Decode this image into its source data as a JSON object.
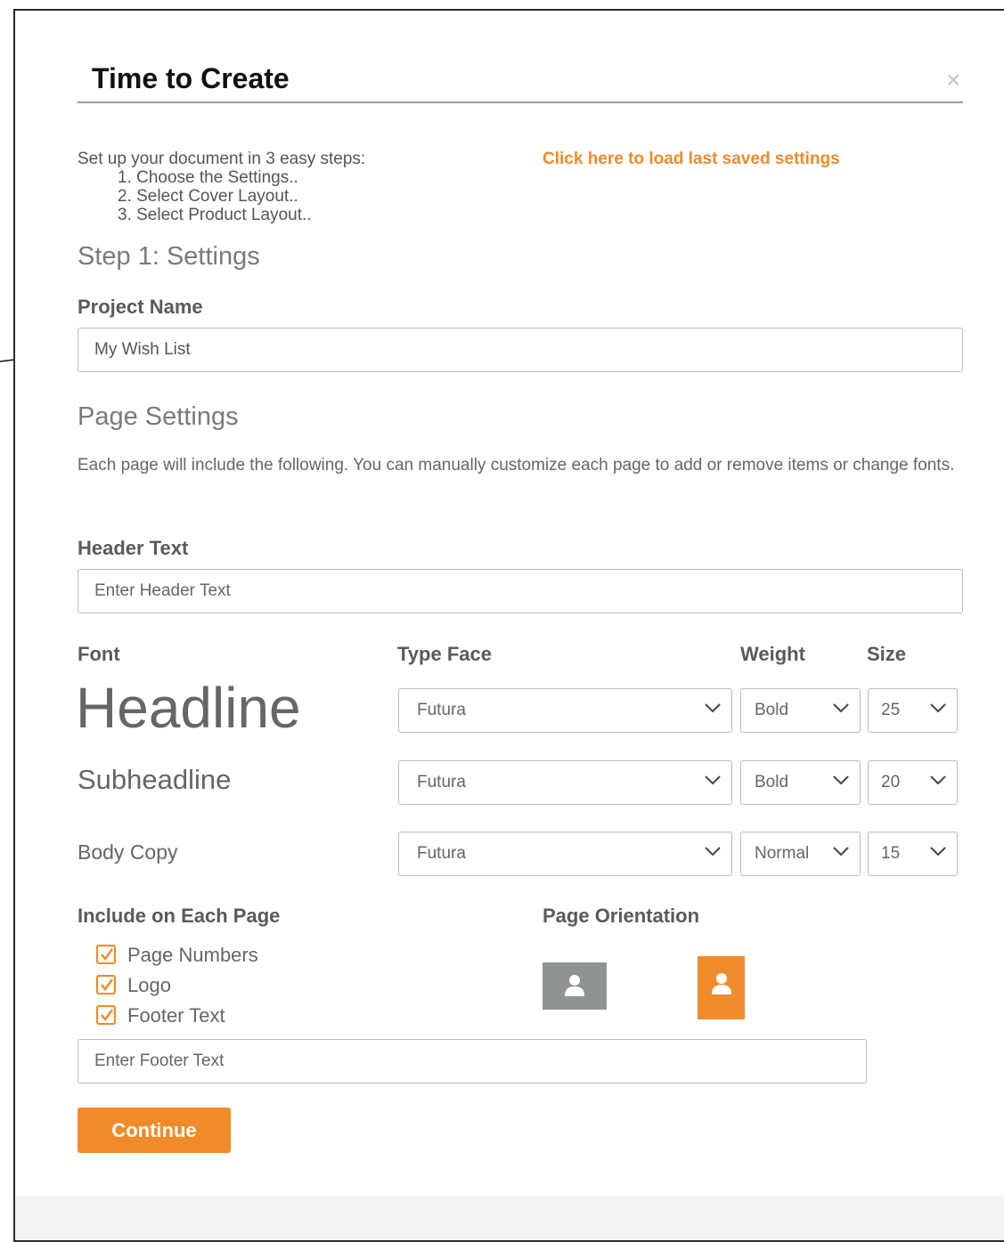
{
  "modal": {
    "title": "Time to Create",
    "close_icon": "close-icon",
    "intro": {
      "heading": "Set up your document in 3 easy steps:",
      "steps": [
        "1. Choose the Settings..",
        "2. Select Cover Layout..",
        "3. Select Product Layout.."
      ]
    },
    "load_settings_link": "Click here to load last saved settings"
  },
  "step1": {
    "heading": "Step 1: Settings",
    "project_name_label": "Project Name",
    "project_name_value": "My Wish List"
  },
  "page_settings": {
    "heading": "Page Settings",
    "description": "Each page will include the following. You can manually customize each page to add or remove items or change fonts.",
    "header_text_label": "Header Text",
    "header_text_placeholder": "Enter Header Text"
  },
  "fonts": {
    "col_font": "Font",
    "col_typeface": "Type Face",
    "col_weight": "Weight",
    "col_size": "Size",
    "rows": [
      {
        "sample": "Headline",
        "typeface": "Futura",
        "weight": "Bold",
        "size": "25"
      },
      {
        "sample": "Subheadline",
        "typeface": "Futura",
        "weight": "Bold",
        "size": "20"
      },
      {
        "sample": "Body Copy",
        "typeface": "Futura",
        "weight": "Normal",
        "size": "15"
      }
    ]
  },
  "include": {
    "heading": "Include on Each Page",
    "items": [
      {
        "label": "Page Numbers",
        "checked": true
      },
      {
        "label": "Logo",
        "checked": true
      },
      {
        "label": "Footer Text",
        "checked": true
      }
    ],
    "footer_text_placeholder": "Enter Footer Text"
  },
  "orientation": {
    "heading": "Page Orientation",
    "landscape_icon": "user-icon",
    "portrait_icon": "user-icon",
    "selected": "portrait"
  },
  "continue_label": "Continue",
  "colors": {
    "accent": "#f18a2a",
    "inactive_orientation": "#8f9394",
    "label_text": "#5a5a5a",
    "heading_text": "#7a7a7a"
  }
}
